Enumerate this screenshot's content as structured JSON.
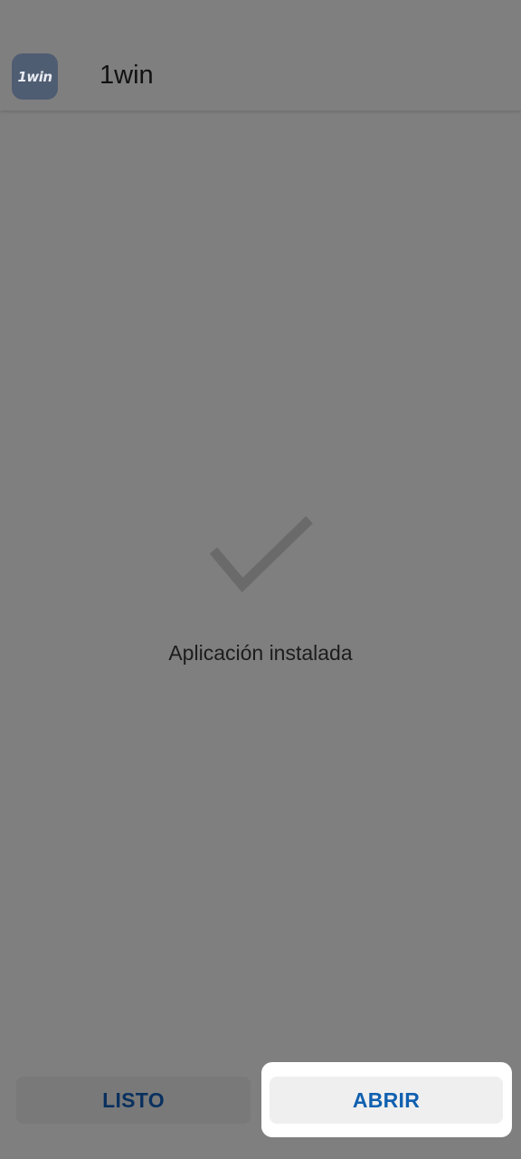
{
  "header": {
    "icon_text": "1win",
    "app_name": "1win"
  },
  "status": {
    "message": "Aplicación instalada",
    "icon": "checkmark-icon"
  },
  "actions": {
    "done_label": "LISTO",
    "open_label": "ABRIR"
  },
  "colors": {
    "dim_background": "#7f7f7f",
    "app_icon_bg": "#4f5d73",
    "open_text": "#1060b0",
    "done_text": "#08305e"
  }
}
